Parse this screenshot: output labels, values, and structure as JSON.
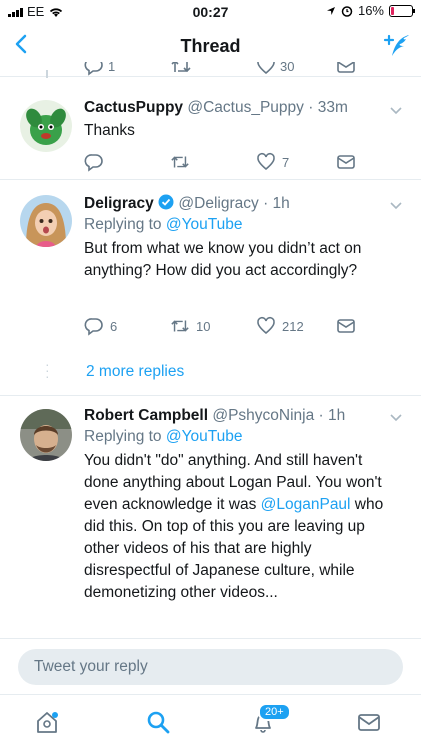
{
  "status_bar": {
    "carrier": "EE",
    "time": "00:27",
    "battery": "16%"
  },
  "navbar": {
    "title": "Thread"
  },
  "prev_tweet": {
    "replies": "1",
    "likes": "30"
  },
  "tweets": [
    {
      "name": "CactusPuppy",
      "handle": "@Cactus_Puppy",
      "time": "· 33m",
      "reply_to_label": "",
      "reply_to_handle": "",
      "text": "Thanks",
      "replies": "",
      "retweets": "",
      "likes": "7"
    },
    {
      "name": "Deligracy",
      "handle": "@Deligracy",
      "time": "· 1h",
      "reply_to_label": "Replying to",
      "reply_to_handle": "@YouTube",
      "text": "But from what we know you didn’t act on anything? How did you act accordingly?",
      "replies": "6",
      "retweets": "10",
      "likes": "212"
    },
    {
      "name": "Robert Campbell",
      "handle": "@PshycoNinja",
      "time": "· 1h",
      "reply_to_label": "Replying to",
      "reply_to_handle": "@YouTube",
      "text_before": "You didn't \"do\" anything. And still haven't done anything about Logan Paul. You won't even acknowledge it was ",
      "text_mention": "@LoganPaul",
      "text_after": " who did this. On top of this you are leaving up other videos of his that are highly disrespectful of Japanese culture, while demonetizing other videos..."
    }
  ],
  "more_replies": {
    "label": "2 more replies"
  },
  "reply_input": {
    "placeholder": "Tweet your reply"
  },
  "tabbar": {
    "notifications_badge": "20+"
  },
  "colors": {
    "accent": "#1da1f2",
    "secondary_text": "#657786",
    "divider": "#e6ecf0",
    "battery_low": "#e0245e"
  }
}
